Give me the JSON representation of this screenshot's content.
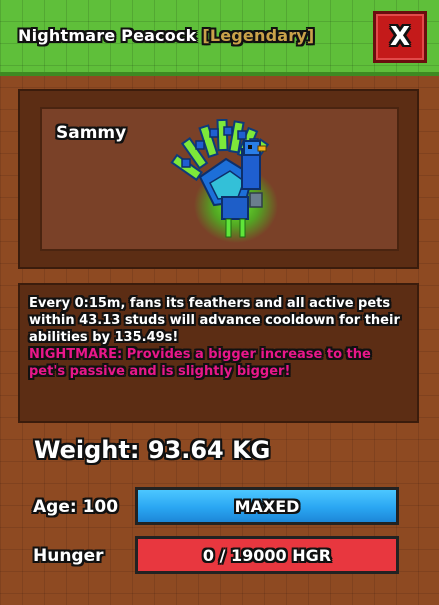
{
  "header": {
    "pet_type": "Nightmare Peacock",
    "rarity": "[Legendary]",
    "close_label": "X",
    "rarity_color": "#c9a24a"
  },
  "pet": {
    "name": "Sammy",
    "model_icon": "peacock-model"
  },
  "description": {
    "ability": "Every 0:15m, fans its feathers and all active pets within 43.13 studs will advance cooldown for their abilities by 135.49s!",
    "mutation_label": "NIGHTMARE:",
    "mutation_text": "Provides a bigger increase to the pet's passive and is slightly bigger!",
    "mutation_color": "#e8178a"
  },
  "stats": {
    "weight_text": "Weight: 93.64 KG",
    "age_label": "Age: 100",
    "age_bar_text": "MAXED",
    "age_fraction": 1.0,
    "hunger_label": "Hunger",
    "hunger_bar_text": "0 / 19000 HGR",
    "hunger_current": 0,
    "hunger_max": 19000
  }
}
